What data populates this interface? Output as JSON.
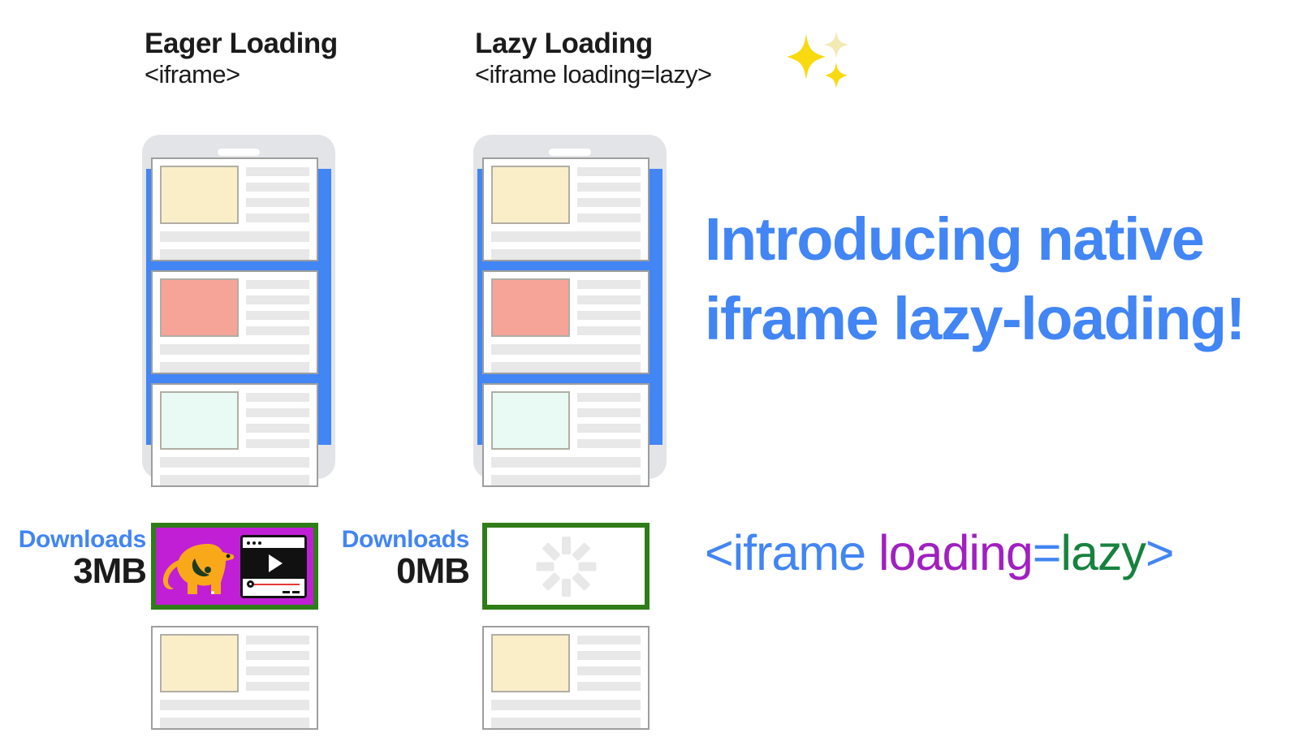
{
  "columns": [
    {
      "title": "Eager Loading",
      "code": "<iframe>"
    },
    {
      "title": "Lazy Loading",
      "code": "<iframe loading=lazy>"
    }
  ],
  "sparkles_icon": "sparkles-icon",
  "downloads": [
    {
      "label": "Downloads",
      "value": "3MB"
    },
    {
      "label": "Downloads",
      "value": "0MB"
    }
  ],
  "headline": "Introducing native iframe lazy-loading!",
  "snippet": {
    "open_tag": "<iframe",
    "attribute": " loading",
    "equals": "=",
    "value": "lazy",
    "close_tag": ">"
  },
  "iframe_eager": {
    "ad_icon": "dog-illustration-icon",
    "player_icon": "video-player-icon"
  },
  "iframe_lazy": {
    "spinner_icon": "loading-spinner-icon"
  },
  "colors": {
    "brand_blue": "#4285f4",
    "token_purple": "#a020c0",
    "token_green": "#17823f",
    "iframe_border_green": "#2f7d18",
    "ad_background": "#c01fd6",
    "thumb_cream": "#faeec8",
    "thumb_salmon": "#f6a398",
    "thumb_mint": "#e9f9f3",
    "phone_bezel": "#e2e4e7"
  }
}
